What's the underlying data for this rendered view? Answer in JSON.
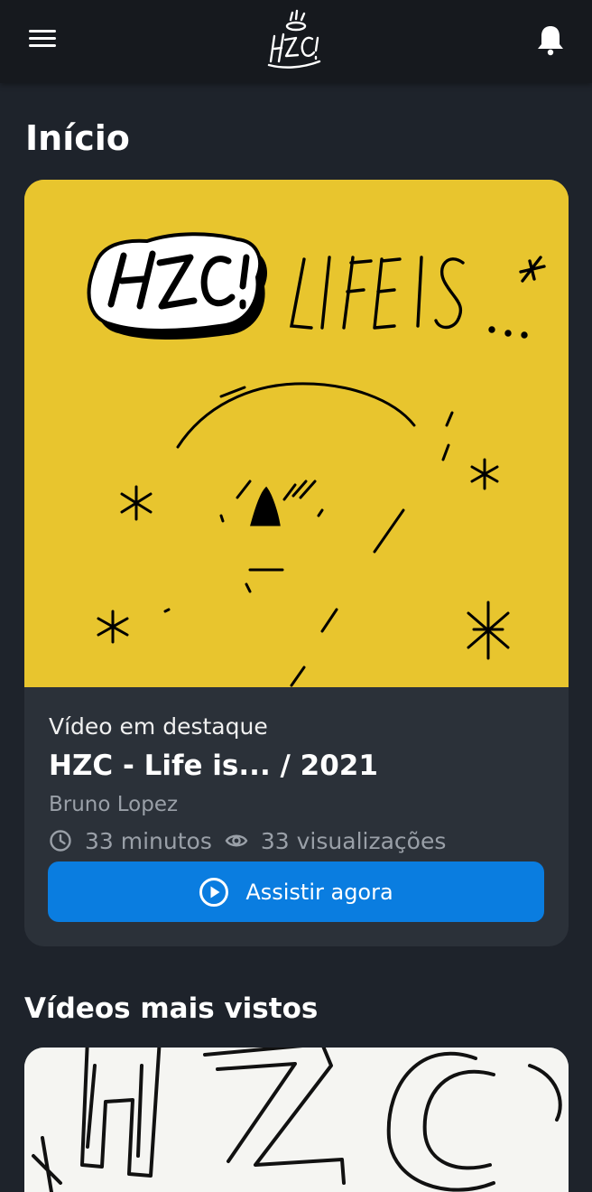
{
  "header": {
    "menu_icon": "hamburger-menu-icon",
    "logo_icon": "hzc-logo",
    "notifications_icon": "bell-icon"
  },
  "page": {
    "title": "Início"
  },
  "featured": {
    "thumbnail_artwork_text": "LIFE IS ...",
    "eyebrow": "Vídeo em destaque",
    "title": "HZC - Life is... / 2021",
    "author": "Bruno Lopez",
    "duration": "33 minutos",
    "views": "33 visualizações",
    "duration_icon": "clock-icon",
    "views_icon": "eye-icon",
    "watch_button": {
      "icon": "play-circle-icon",
      "label": "Assistir agora"
    }
  },
  "popular": {
    "title": "Vídeos mais vistos"
  },
  "colors": {
    "background": "#1e232b",
    "appbar": "#16191e",
    "card": "#2b3139",
    "accent": "#0a7de0",
    "thumbnail_yellow": "#e8c52e",
    "muted_text": "#9aa0a8"
  }
}
